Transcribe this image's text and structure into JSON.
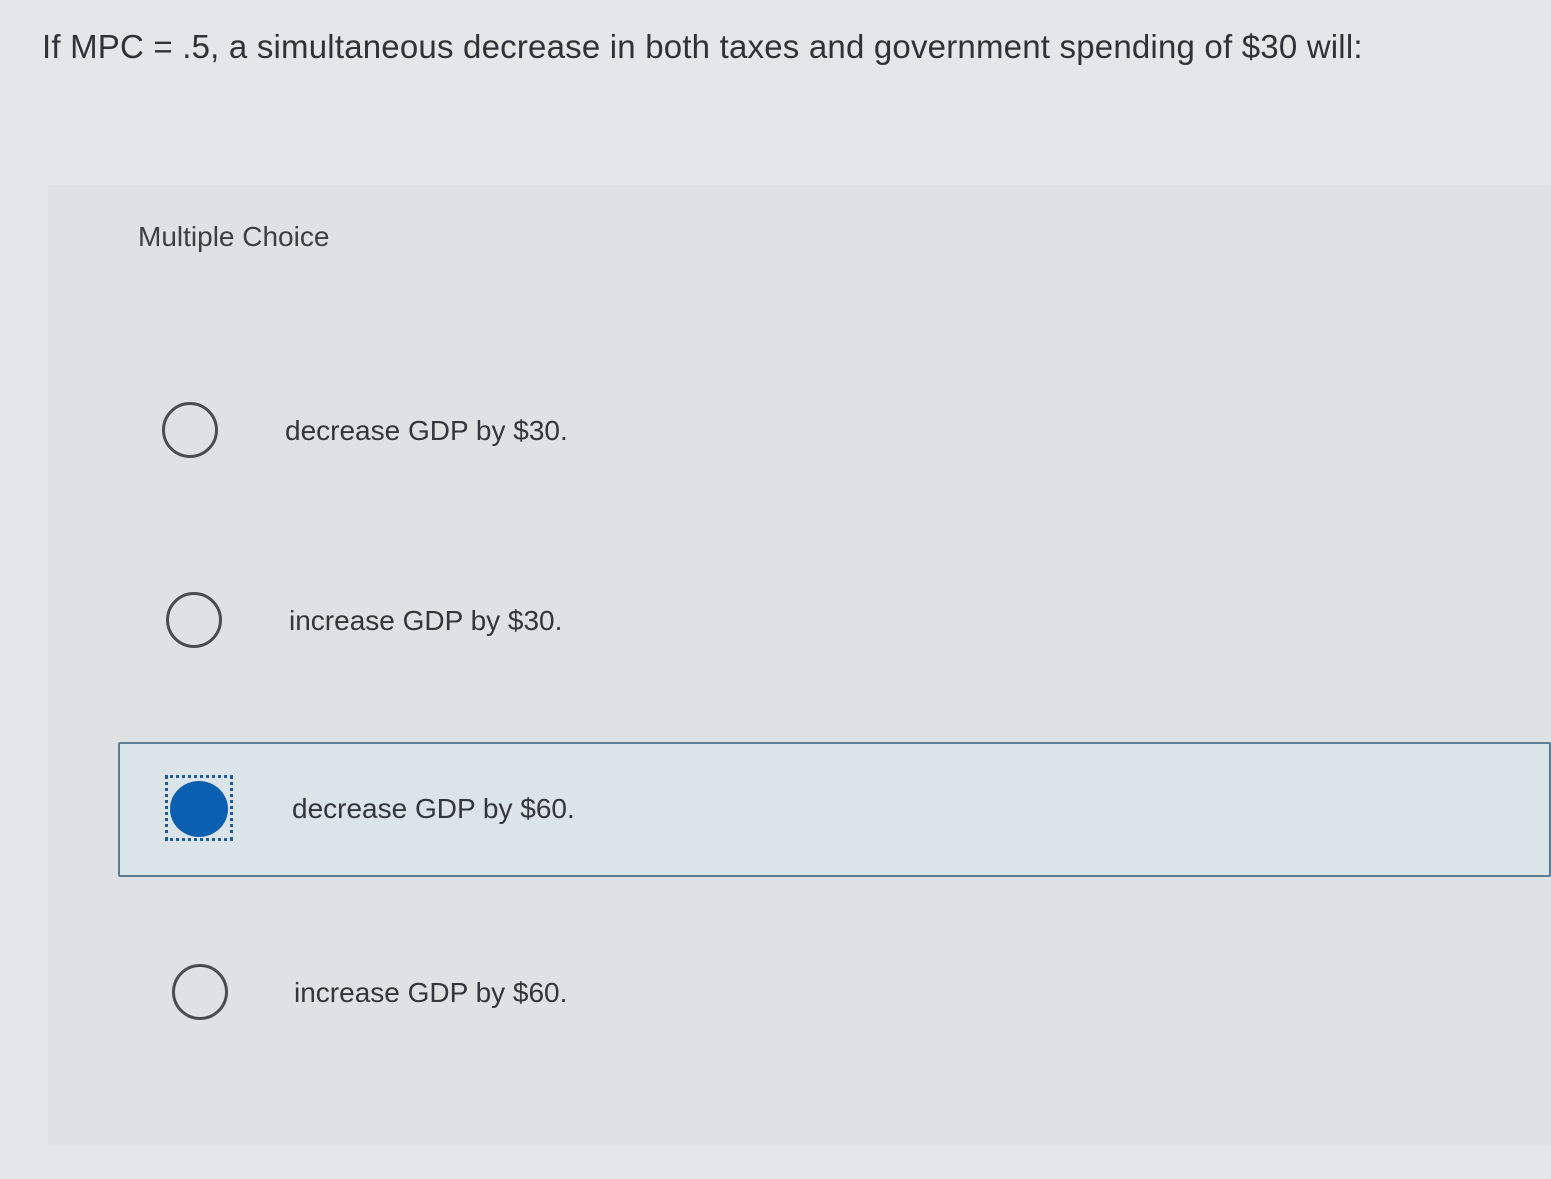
{
  "question": {
    "text": "If MPC = .5, a simultaneous decrease in both taxes and government spending of $30 will:"
  },
  "panel": {
    "header": "Multiple Choice"
  },
  "options": [
    {
      "label": "decrease GDP by $30.",
      "selected": false
    },
    {
      "label": "increase GDP by $30.",
      "selected": false
    },
    {
      "label": "decrease GDP by $60.",
      "selected": true
    },
    {
      "label": "increase GDP by $60.",
      "selected": false
    }
  ],
  "colors": {
    "selected_fill": "#0b5fb0",
    "selected_border": "#5c7c94",
    "selected_background": "#dbe4e8"
  }
}
